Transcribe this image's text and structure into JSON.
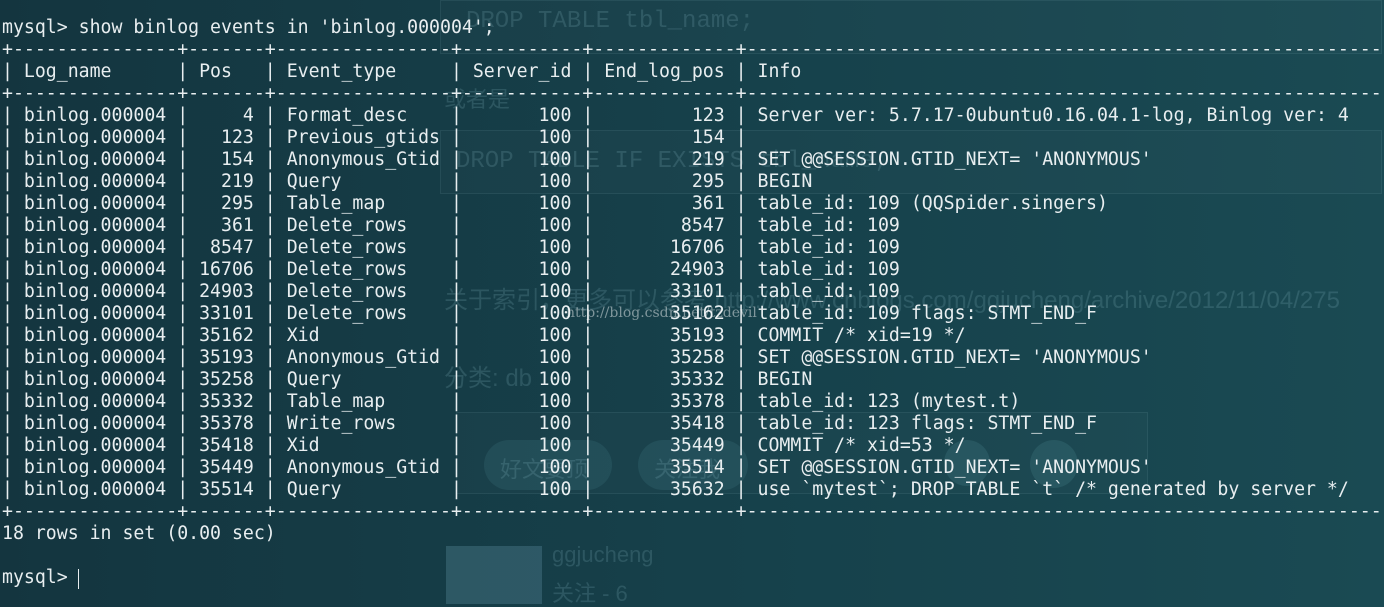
{
  "terminal": {
    "command_line": "mysql> show binlog events in 'binlog.000004';",
    "border": "+---------------+-------+----------------+-----------+-------------+---------------------------------------------------------------------------+",
    "columns": [
      "Log_name",
      "Pos",
      "Event_type",
      "Server_id",
      "End_log_pos",
      "Info"
    ],
    "rows": [
      [
        "binlog.000004",
        "4",
        "Format_desc",
        "100",
        "123",
        "Server ver: 5.7.17-0ubuntu0.16.04.1-log, Binlog ver: 4"
      ],
      [
        "binlog.000004",
        "123",
        "Previous_gtids",
        "100",
        "154",
        ""
      ],
      [
        "binlog.000004",
        "154",
        "Anonymous_Gtid",
        "100",
        "219",
        "SET @@SESSION.GTID_NEXT= 'ANONYMOUS'"
      ],
      [
        "binlog.000004",
        "219",
        "Query",
        "100",
        "295",
        "BEGIN"
      ],
      [
        "binlog.000004",
        "295",
        "Table_map",
        "100",
        "361",
        "table_id: 109 (QQSpider.singers)"
      ],
      [
        "binlog.000004",
        "361",
        "Delete_rows",
        "100",
        "8547",
        "table_id: 109"
      ],
      [
        "binlog.000004",
        "8547",
        "Delete_rows",
        "100",
        "16706",
        "table_id: 109"
      ],
      [
        "binlog.000004",
        "16706",
        "Delete_rows",
        "100",
        "24903",
        "table_id: 109"
      ],
      [
        "binlog.000004",
        "24903",
        "Delete_rows",
        "100",
        "33101",
        "table_id: 109"
      ],
      [
        "binlog.000004",
        "33101",
        "Delete_rows",
        "100",
        "35162",
        "table_id: 109 flags: STMT_END_F"
      ],
      [
        "binlog.000004",
        "35162",
        "Xid",
        "100",
        "35193",
        "COMMIT /* xid=19 */"
      ],
      [
        "binlog.000004",
        "35193",
        "Anonymous_Gtid",
        "100",
        "35258",
        "SET @@SESSION.GTID_NEXT= 'ANONYMOUS'"
      ],
      [
        "binlog.000004",
        "35258",
        "Query",
        "100",
        "35332",
        "BEGIN"
      ],
      [
        "binlog.000004",
        "35332",
        "Table_map",
        "100",
        "35378",
        "table_id: 123 (mytest.t)"
      ],
      [
        "binlog.000004",
        "35378",
        "Write_rows",
        "100",
        "35418",
        "table_id: 123 flags: STMT_END_F"
      ],
      [
        "binlog.000004",
        "35418",
        "Xid",
        "100",
        "35449",
        "COMMIT /* xid=53 */"
      ],
      [
        "binlog.000004",
        "35449",
        "Anonymous_Gtid",
        "100",
        "35514",
        "SET @@SESSION.GTID_NEXT= 'ANONYMOUS'"
      ],
      [
        "binlog.000004",
        "35514",
        "Query",
        "100",
        "35632",
        "use `mytest`; DROP TABLE `t` /* generated by server */"
      ]
    ],
    "summary": "18 rows in set (0.00 sec)",
    "prompt": "mysql> "
  },
  "watermark": "http://blog.csdn.net/tzdevil",
  "background_ghost": {
    "drop_table": "DROP TABLE  tbl_name;",
    "or": "或者是",
    "drop_if_exists": "DROP TABLE IF EXISTS tbl_name;",
    "about_index": "关于索引，更多可以参考 http://www.cnblogs.com/ggjucheng/archive/2012/11/04/275",
    "category": "分类: db",
    "good": "好文要顶",
    "follow": "关注我",
    "author": "ggjucheng",
    "fans": "关注 - 6"
  },
  "colors": {
    "background": "#163a44",
    "text": "#e8eef0"
  }
}
